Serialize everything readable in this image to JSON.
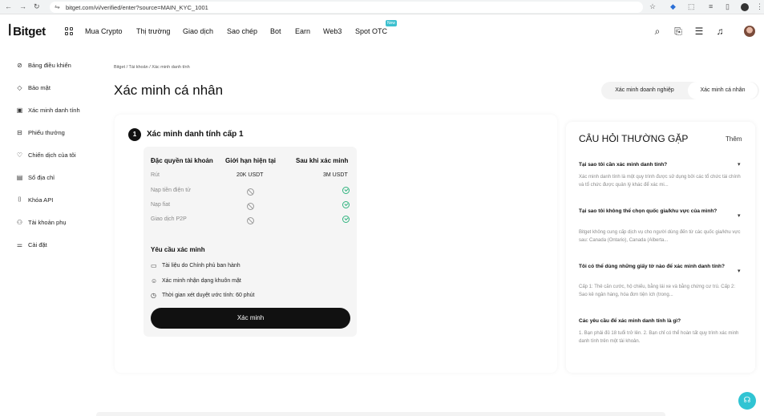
{
  "browser": {
    "url": "bitget.com/vi/verified/enter?source=MAIN_KYC_1001",
    "back_icon": "arrow-left-icon",
    "forward_icon": "arrow-right-icon",
    "reload_icon": "reload-icon"
  },
  "header": {
    "logo_text": "Bitget",
    "nav": [
      "Mua Crypto",
      "Thị trường",
      "Giao dịch",
      "Sao chép",
      "Bot",
      "Earn",
      "Web3",
      "Spot OTC"
    ],
    "new_badge": "New"
  },
  "sidebar": {
    "items": [
      {
        "label": "Bảng điều khiển",
        "icon": "dashboard-icon"
      },
      {
        "label": "Bảo mật",
        "icon": "shield-icon"
      },
      {
        "label": "Xác minh danh tính",
        "icon": "id-card-icon"
      },
      {
        "label": "Phiếu thưởng",
        "icon": "coupon-icon"
      },
      {
        "label": "Chiến dịch của tôi",
        "icon": "heart-icon"
      },
      {
        "label": "Sổ địa chỉ",
        "icon": "address-book-icon"
      },
      {
        "label": "Khóa API",
        "icon": "api-icon"
      },
      {
        "label": "Tài khoản phụ",
        "icon": "sub-account-icon"
      },
      {
        "label": "Cài đặt",
        "icon": "settings-icon"
      }
    ]
  },
  "main": {
    "breadcrumb": "Bitget  /  Tài khoản  /  Xác minh danh tính",
    "title": "Xác minh cá nhân",
    "tabs": [
      {
        "label": "Xác minh doanh nghiệp",
        "active": false
      },
      {
        "label": "Xác minh cá nhân",
        "active": true
      }
    ],
    "step": {
      "number": "1",
      "title": "Xác minh danh tính cấp 1"
    },
    "table": {
      "headers": [
        "Đặc quyền tài khoản",
        "Giới hạn hiện tại",
        "Sau khi xác minh"
      ],
      "rows": [
        {
          "label": "Rút",
          "current": "20K USDT",
          "after": "3M USDT"
        },
        {
          "label": "Nạp tiền điện tử",
          "current_icon": "blocked-icon",
          "after_icon": "check-circle-icon"
        },
        {
          "label": "Nạp fiat",
          "current_icon": "blocked-icon",
          "after_icon": "check-circle-icon"
        },
        {
          "label": "Giao dịch P2P",
          "current_icon": "blocked-icon",
          "after_icon": "check-circle-icon"
        }
      ]
    },
    "requirements": {
      "title": "Yêu cầu xác minh",
      "items": [
        {
          "label": "Tài liệu do Chính phủ ban hành",
          "icon": "document-icon"
        },
        {
          "label": "Xác minh nhận dạng khuôn mặt",
          "icon": "face-icon"
        },
        {
          "label": "Thời gian xét duyệt ước tính: 60 phút",
          "icon": "clock-icon"
        }
      ]
    },
    "verify_button": "Xác minh"
  },
  "faq": {
    "title": "CÂU HỎI THƯỜNG GẶP",
    "more": "Thêm",
    "items": [
      {
        "question": "Tại sao tôi cần xác minh danh tính?",
        "answer": "Xác minh danh tính là một quy trình được sử dụng bởi các tổ chức tài chính và tổ chức được quản lý khác để xác mi..."
      },
      {
        "question": "Tại sao tôi không thể chọn quốc gia/khu vực của mình?",
        "answer": "Bitget không cung cấp dịch vụ cho người dùng đến từ các quốc gia/khu vực sau: Canada (Ontario), Canada (Alberta..."
      },
      {
        "question": "Tôi có thể dùng những giấy tờ nào để xác minh danh tính?",
        "answer": "Cấp 1: Thẻ căn cước, hộ chiếu, bằng lái xe và bằng chứng cư trú. Cấp 2: Sao kê ngân hàng, hóa đơn tiện ích (trong..."
      },
      {
        "question": "Các yêu cầu để xác minh danh tính là gì?",
        "answer": "1. Bạn phải đủ 18 tuổi trở lên. 2. Bạn chỉ có thể hoàn tất quy trình xác minh danh tính trên một tài khoản."
      }
    ]
  },
  "colors": {
    "accent_check": "#2fb37e",
    "support_button": "#30c4d3",
    "new_badge": "#3cc0cf"
  }
}
